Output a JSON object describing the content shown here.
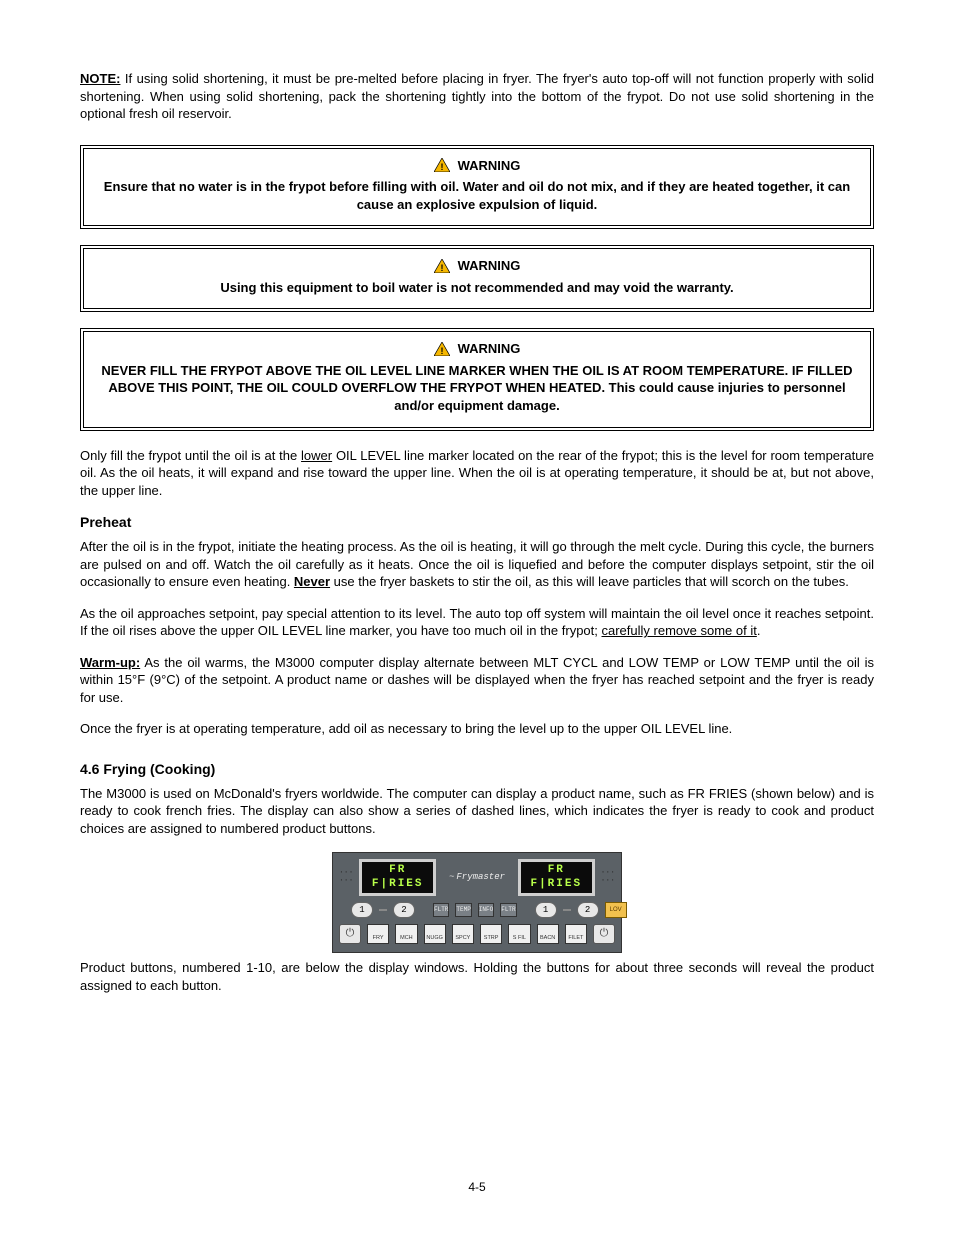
{
  "intro": {
    "note_label": "NOTE:",
    "text": " If using solid shortening, it must be pre-melted before placing in fryer. The fryer's auto top-off will not function properly with solid shortening. When using solid shortening, pack the shortening tightly into the bottom of the frypot. Do not use solid shortening in the optional fresh oil reservoir."
  },
  "warnings": [
    {
      "title": "WARNING",
      "text": "Ensure that no water is in the frypot before filling with oil. Water and oil do not mix, and if they are heated together, it can cause an explosive expulsion of liquid."
    },
    {
      "title": "WARNING",
      "text": "Using this equipment to boil water is not recommended and may void the warranty."
    },
    {
      "title": "WARNING",
      "text": "NEVER FILL THE FRYPOT ABOVE THE OIL LEVEL LINE MARKER WHEN THE OIL IS AT ROOM TEMPERATURE. IF FILLED ABOVE THIS POINT, THE OIL COULD OVERFLOW THE FRYPOT WHEN HEATED. This could cause injuries to personnel and/or equipment damage."
    }
  ],
  "para_fill_line": {
    "pre": "Only fill the frypot until the oil is at the ",
    "lower_word": "lower",
    "after_lower": " OIL LEVEL line marker located on the rear of the frypot; this is the level for room temperature oil. As the oil heats, it will expand and rise toward the upper line. When the oil is at operating temperature, it should be at, but not above, the upper line."
  },
  "preheat": {
    "heading": "Preheat",
    "first_para": "After the oil is in the frypot, initiate the heating process. As the oil is heating, it will go through the melt cycle. During this cycle, the burners are pulsed on and off. Watch the oil carefully as it heats. Once the oil is liquefied and before the computer displays setpoint, stir the oil occasionally to ensure even heating. ",
    "never_word": "Never",
    "after_never": " use the fryer baskets to stir the oil, as this will leave particles that will scorch on the tubes.",
    "second_pre": "As the oil approaches setpoint, pay special attention to its level. The auto top off system will maintain the oil level once it reaches setpoint. If the oil rises above the upper OIL LEVEL line marker, you have too much oil in the frypot; ",
    "second_underline": "carefully remove some of it",
    "second_post": ".",
    "warmup_label": "Warm-up:",
    "warmup_text": " As the oil warms, the M3000 computer display alternate between MLT CYCL and LOW TEMP or LOW TEMP until the oil is within 15°F (9°C) of the setpoint. A product name or dashes will be displayed when the fryer has reached setpoint and the fryer is ready for use.",
    "last_para": "Once the fryer is at operating temperature, add oil as necessary to bring the level up to the upper OIL LEVEL line."
  },
  "cooking": {
    "heading": "4.6 Frying (Cooking)",
    "lead": "The M3000 is used on McDonald's fryers worldwide. The computer can display a product name, such as FR FRIES (shown below) and is ready to cook french fries. The display can also show a series of dashed lines, which indicates the fryer is ready to cook and product choices are assigned to numbered product buttons.",
    "panel": {
      "brand": "Frymaster",
      "lcd_left": "FR F|RIES",
      "lcd_right": "FR F|RIES",
      "chan_btns": [
        "1",
        "2"
      ],
      "mini_btns": [
        "FLTR",
        "TEMP",
        "INFO",
        "FLTR"
      ],
      "lov_label": "LOV",
      "sq_btns": [
        "FRY",
        "MCH",
        "NUGG",
        "SPCY",
        "STRP",
        "S FIL",
        "BACN",
        "FILET"
      ],
      "power_glyph": "⏻"
    },
    "tail": "Product buttons, numbered 1-10, are below the display windows. Holding the buttons for about three seconds will reveal the product assigned to each button."
  },
  "page_number": "4-5"
}
